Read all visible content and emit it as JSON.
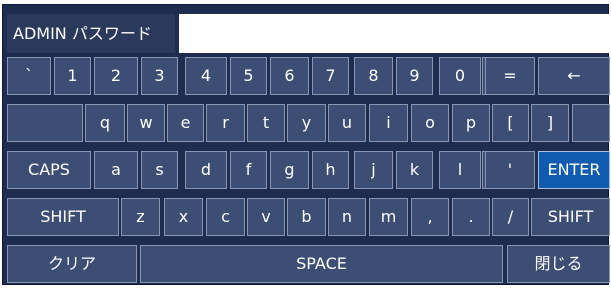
{
  "password": {
    "label": "ADMIN パスワード",
    "value": "",
    "placeholder": ""
  },
  "keyboard": {
    "row1": [
      "`",
      "1",
      "2",
      "3",
      "4",
      "5",
      "6",
      "7",
      "8",
      "9",
      "0",
      "-",
      "=",
      "←"
    ],
    "row2": [
      "",
      "q",
      "w",
      "e",
      "r",
      "t",
      "y",
      "u",
      "i",
      "o",
      "p",
      "[",
      "]",
      ""
    ],
    "row3": [
      "CAPS",
      "a",
      "s",
      "d",
      "f",
      "g",
      "h",
      "j",
      "k",
      "l",
      ";",
      "'",
      "ENTER"
    ],
    "row4": [
      "SHIFT",
      "z",
      "x",
      "c",
      "v",
      "b",
      "n",
      "m",
      ",",
      ".",
      "/",
      "SHIFT"
    ],
    "row5": [
      "クリア",
      "SPACE",
      "閉じる"
    ]
  },
  "colors": {
    "background": "#1d2c4f",
    "key": "#3c4e74",
    "enter_key": "#0f5bb0"
  }
}
